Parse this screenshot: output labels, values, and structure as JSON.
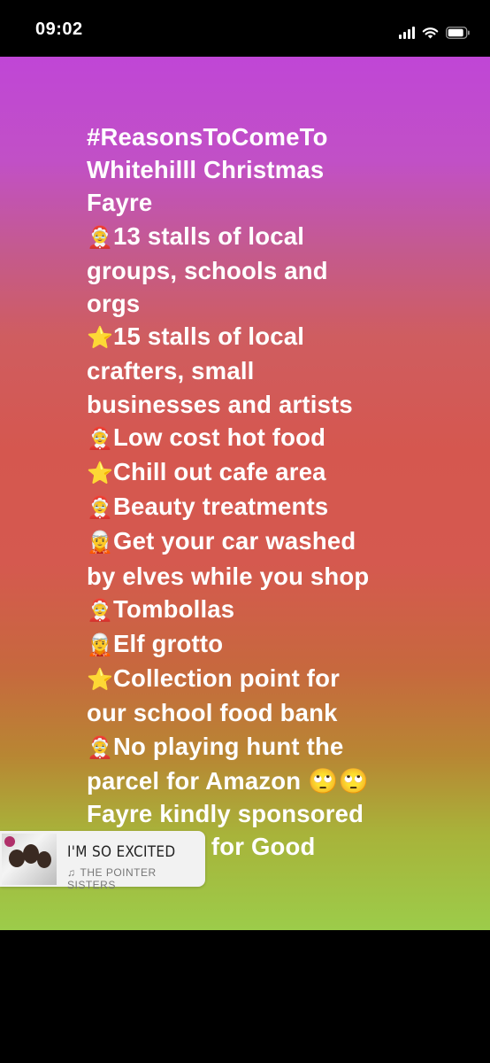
{
  "status_bar": {
    "time": "09:02"
  },
  "story": {
    "lines": [
      {
        "emoji": "",
        "text": "#ReasonsToComeTo"
      },
      {
        "emoji": "",
        "text": "Whitehilll Christmas"
      },
      {
        "emoji": "",
        "text": "Fayre"
      },
      {
        "emoji": "🤶",
        "text": "13 stalls of local"
      },
      {
        "emoji": "",
        "text": "groups, schools and"
      },
      {
        "emoji": "",
        "text": "orgs"
      },
      {
        "emoji": "⭐",
        "text": "15 stalls of local"
      },
      {
        "emoji": "",
        "text": "crafters, small"
      },
      {
        "emoji": "",
        "text": "businesses and artists"
      },
      {
        "emoji": "🤶",
        "text": "Low cost hot food"
      },
      {
        "emoji": "⭐",
        "text": "Chill out cafe area"
      },
      {
        "emoji": "🤶",
        "text": "Beauty treatments"
      },
      {
        "emoji": "🧝",
        "text": "Get your car washed"
      },
      {
        "emoji": "",
        "text": "by elves while you shop"
      },
      {
        "emoji": "🤶",
        "text": "Tombollas"
      },
      {
        "emoji": "🧝",
        "text": "Elf grotto"
      },
      {
        "emoji": "⭐",
        "text": "Collection point for"
      },
      {
        "emoji": "",
        "text": "our school food bank"
      },
      {
        "emoji": "🤶",
        "text": "No playing hunt the"
      },
      {
        "emoji": "",
        "text": "parcel for Amazon 🙄🙄"
      },
      {
        "emoji": "",
        "text": "Fayre kindly sponsored"
      },
      {
        "emoji": "",
        "text": "by Homes for Good"
      }
    ]
  },
  "music_sticker": {
    "song_title": "I'M SO EXCITED",
    "artist": "THE POINTER SISTERS",
    "note_icon": "♫"
  }
}
